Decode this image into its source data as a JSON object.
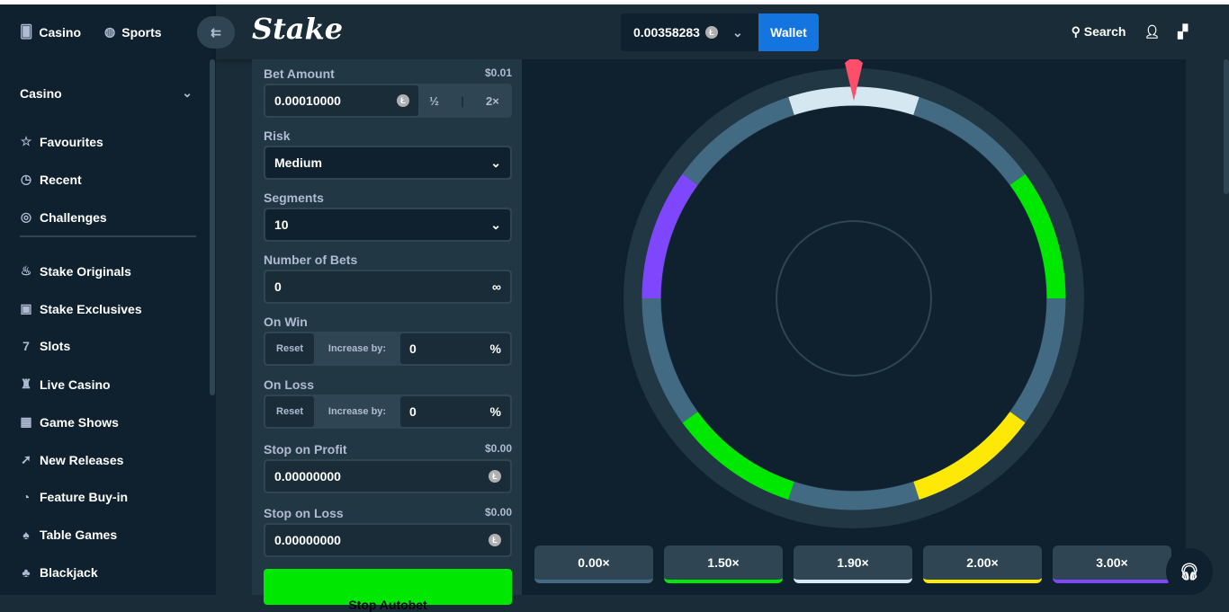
{
  "nav": {
    "casino": "Casino",
    "sports": "Sports",
    "logo": "Stake"
  },
  "header": {
    "balance": "0.00358283",
    "wallet": "Wallet",
    "search": "Search"
  },
  "sidebar": {
    "section": "Casino",
    "items": [
      {
        "label": "Favourites",
        "icon": "☆"
      },
      {
        "label": "Recent",
        "icon": "◷"
      },
      {
        "label": "Challenges",
        "icon": "◎"
      },
      {
        "label": "Stake Originals",
        "icon": "♨"
      },
      {
        "label": "Stake Exclusives",
        "icon": "▣"
      },
      {
        "label": "Slots",
        "icon": "7"
      },
      {
        "label": "Live Casino",
        "icon": "♜"
      },
      {
        "label": "Game Shows",
        "icon": "▦"
      },
      {
        "label": "New Releases",
        "icon": "➚"
      },
      {
        "label": "Feature Buy-in",
        "icon": "◔"
      },
      {
        "label": "Table Games",
        "icon": "♠"
      },
      {
        "label": "Blackjack",
        "icon": "♣"
      }
    ]
  },
  "panel": {
    "bet_amount": {
      "label": "Bet Amount",
      "usd": "$0.01",
      "value": "0.00010000",
      "half": "½",
      "double": "2×"
    },
    "risk": {
      "label": "Risk",
      "value": "Medium"
    },
    "segments": {
      "label": "Segments",
      "value": "10"
    },
    "num_bets": {
      "label": "Number of Bets",
      "value": "0"
    },
    "on_win": {
      "label": "On Win",
      "reset": "Reset",
      "increase": "Increase by:",
      "value": "0",
      "unit": "%"
    },
    "on_loss": {
      "label": "On Loss",
      "reset": "Reset",
      "increase": "Increase by:",
      "value": "0",
      "unit": "%"
    },
    "stop_profit": {
      "label": "Stop on Profit",
      "usd": "$0.00",
      "value": "0.00000000"
    },
    "stop_loss": {
      "label": "Stop on Loss",
      "usd": "$0.00",
      "value": "0.00000000"
    },
    "stop_button": "Stop Autobet"
  },
  "wheel": {
    "segments": [
      "#d5e8f2",
      "#426a82",
      "#00e701",
      "#426a82",
      "#fde905",
      "#426a82",
      "#00e701",
      "#426a82",
      "#7f47fd",
      "#426a82"
    ]
  },
  "multipliers": [
    {
      "label": "0.00×",
      "color": "#426a82"
    },
    {
      "label": "1.50×",
      "color": "#00e701"
    },
    {
      "label": "1.90×",
      "color": "#d5e8f2"
    },
    {
      "label": "2.00×",
      "color": "#fde905"
    },
    {
      "label": "3.00×",
      "color": "#7f47fd"
    }
  ]
}
